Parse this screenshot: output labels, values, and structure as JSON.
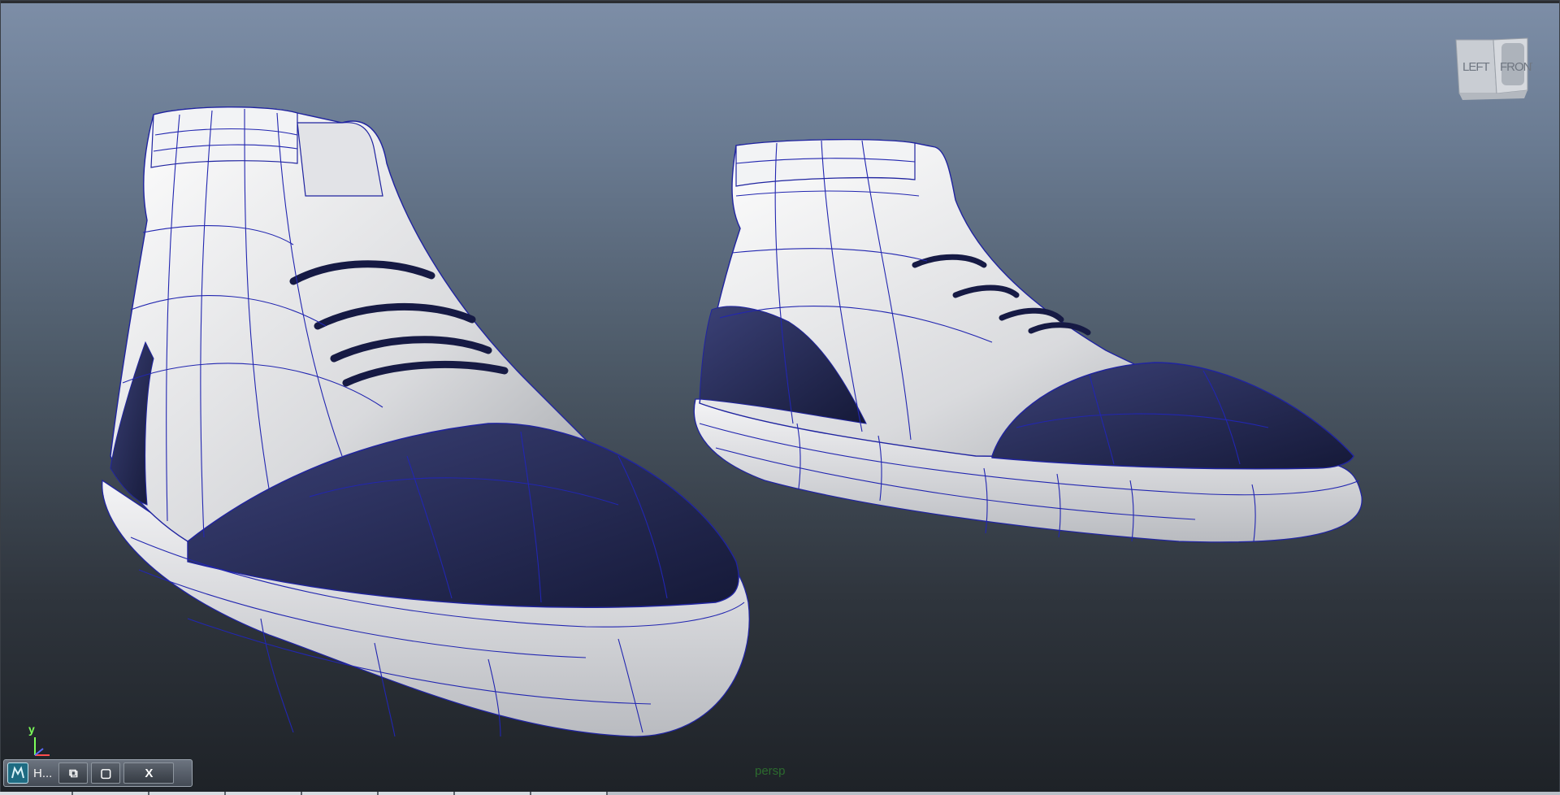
{
  "viewport": {
    "camera_label": "persp",
    "view_cube": {
      "left_face": "LEFT",
      "front_face": "FRONT"
    },
    "axis": {
      "y_label": "y"
    }
  },
  "taskbar": {
    "app_title": "H...",
    "buttons": {
      "restore": "⧉",
      "maximize": "▢",
      "close": "X"
    }
  },
  "colors": {
    "viewport_top": "#7d8ea7",
    "viewport_bottom": "#1e2227",
    "shoe_white": "#e6e7ea",
    "shoe_navy": "#22275e",
    "wireframe": "#1f22a8",
    "camera_label": "#2c6b2e"
  }
}
